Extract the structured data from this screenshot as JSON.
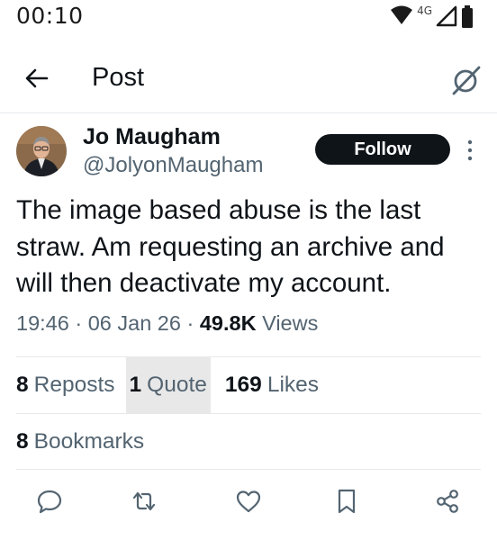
{
  "status_bar": {
    "time": "00:10",
    "network_label": "4G",
    "icons": [
      "wifi-icon",
      "signal-icon",
      "battery-icon"
    ]
  },
  "header": {
    "title": "Post",
    "back_icon": "back-arrow-icon",
    "grok_icon": "grok-icon"
  },
  "author": {
    "display_name": "Jo Maugham",
    "handle": "@JolyonMaugham",
    "follow_label": "Follow"
  },
  "post": {
    "text": "The image based abuse is the last straw. Am requesting an archive and will then deactivate my account.",
    "time": "19:46",
    "separator1": " · ",
    "date": "06 Jan 26",
    "separator2": " · ",
    "views_count": "49.8K",
    "views_label": "Views"
  },
  "stats": {
    "reposts_count": "8",
    "reposts_label": "Reposts",
    "quotes_count": "1",
    "quotes_label": "Quote",
    "likes_count": "169",
    "likes_label": "Likes",
    "bookmarks_count": "8",
    "bookmarks_label": "Bookmarks"
  },
  "actions": [
    "reply-icon",
    "repost-icon",
    "like-icon",
    "bookmark-icon",
    "share-icon"
  ],
  "colors": {
    "text_primary": "#0f1419",
    "text_secondary": "#536471",
    "divider": "#e6e9eb",
    "action_icon": "#536471",
    "highlight_bg": "#e8e8e8"
  }
}
